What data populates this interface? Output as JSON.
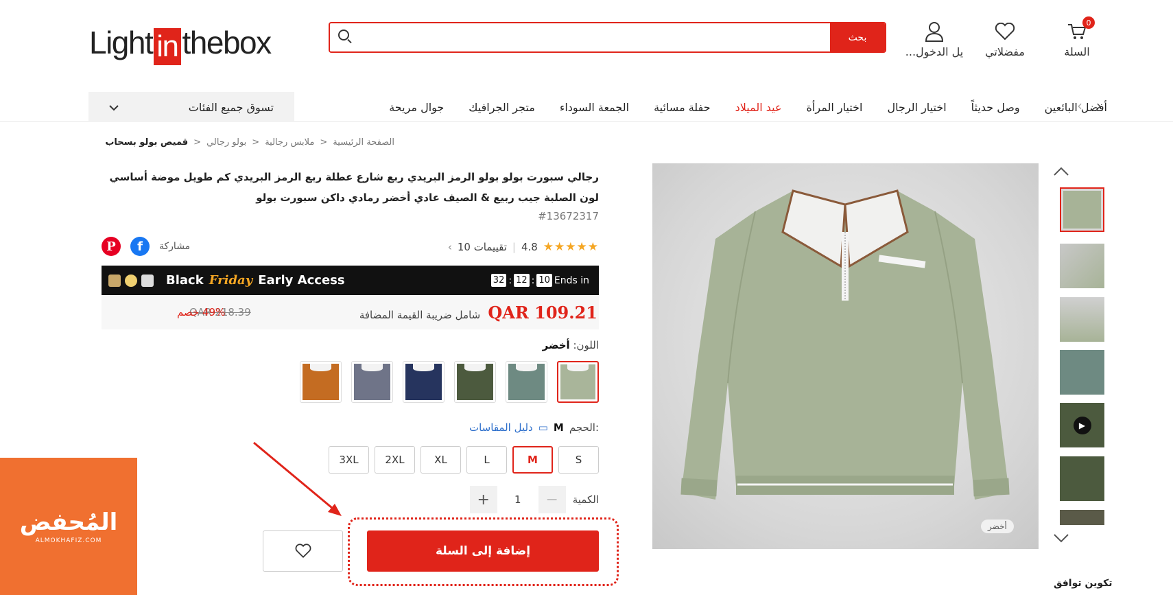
{
  "header": {
    "logo": {
      "left": "Light",
      "mid": "in",
      "right": "thebox"
    },
    "search": {
      "button": "بحث",
      "placeholder": ""
    },
    "login": "...يل الدخول",
    "favorites": "مفضلاتي",
    "cart": "السلة",
    "cart_count": "0"
  },
  "nav": {
    "categories_button": "تسوق جميع الفئات",
    "links": [
      "أفضل البائعين",
      "وصل حديثاً",
      "اختيار الرجال",
      "اختيار المرأة",
      "عيد الميلاد",
      "حفلة مسائية",
      "الجمعة السوداء",
      "متجر الجرافيك",
      "جوال مريحة"
    ],
    "highlight_index": 4
  },
  "breadcrumb": [
    "الصفحة الرئيسية",
    "ملابس رجالية",
    "بولو رجالي",
    "قميص بولو بسحاب"
  ],
  "product": {
    "title": "رجالي سبورت بولو بولو الرمز البريدي ربع شارع عطلة ربع الرمز البريدي كم طويل موضة أساسي لون الصلبة جيب ربيع & الصيف عادي أخضر رمادي داكن سبورت بولو",
    "id": "#13672317",
    "rating": "4.8",
    "stars": "★★★★★",
    "reviews": "10 تقييمات",
    "share_label": "مشاركة",
    "promo": {
      "title_a": "Black",
      "title_b": "Friday",
      "title_c": "Early Access",
      "ends_label": "Ends in",
      "timer": [
        "10",
        "12",
        "32"
      ]
    },
    "price": "QAR 109.21",
    "vat": "شامل ضريبة القيمة المضافة",
    "old_price": "QAR 218.39",
    "discount": "49% خصم",
    "color_label": "اللون:",
    "color_value": "أخضر",
    "swatch_colors": [
      "#a9b59a",
      "#6e8a82",
      "#4c5a3e",
      "#26345e",
      "#6f7488",
      "#c46c22"
    ],
    "size_label": "الحجم:",
    "size_value": "M",
    "size_guide": "دليل المقاسات",
    "sizes": [
      "S",
      "M",
      "L",
      "XL",
      "2XL",
      "3XL"
    ],
    "selected_size": "M",
    "qty_label": "الكمية",
    "qty_value": "1",
    "add_to_cart": "إضافة إلى السلة",
    "image_color_tag": "أخضر",
    "side_text": "تكوين توافق"
  },
  "watermark": {
    "title": "المُحفض",
    "sub": "ALMOKHAFIZ.COM"
  },
  "colors": {
    "accent": "#e0241a",
    "shirt": "#a7b397"
  }
}
